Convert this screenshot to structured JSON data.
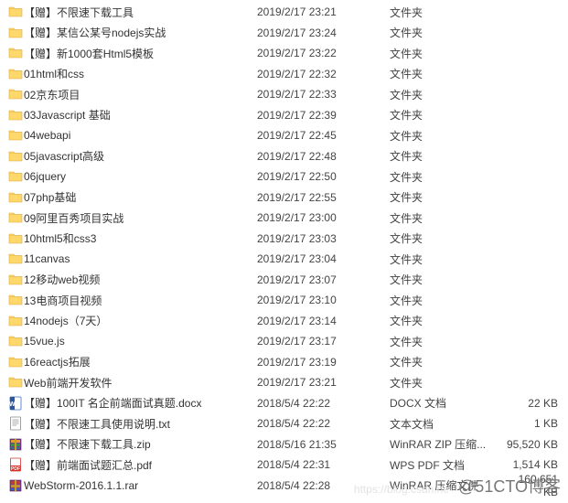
{
  "watermark": "@51CTO博客",
  "watermark_faint": "https://blog.csdn.ne",
  "icons": {
    "folder": "folder",
    "docx": "docx",
    "txt": "txt",
    "zip": "zip",
    "pdf": "pdf",
    "rar": "rar"
  },
  "rows": [
    {
      "icon": "folder",
      "name": "【赠】不限速下载工具",
      "date": "2019/2/17 23:21",
      "type": "文件夹",
      "size": ""
    },
    {
      "icon": "folder",
      "name": "【赠】某信公某号nodejs实战",
      "date": "2019/2/17 23:24",
      "type": "文件夹",
      "size": ""
    },
    {
      "icon": "folder",
      "name": "【赠】新1000套Html5模板",
      "date": "2019/2/17 23:22",
      "type": "文件夹",
      "size": ""
    },
    {
      "icon": "folder",
      "name": "01html和css",
      "date": "2019/2/17 22:32",
      "type": "文件夹",
      "size": ""
    },
    {
      "icon": "folder",
      "name": "02京东项目",
      "date": "2019/2/17 22:33",
      "type": "文件夹",
      "size": ""
    },
    {
      "icon": "folder",
      "name": "03Javascript 基础",
      "date": "2019/2/17 22:39",
      "type": "文件夹",
      "size": ""
    },
    {
      "icon": "folder",
      "name": "04webapi",
      "date": "2019/2/17 22:45",
      "type": "文件夹",
      "size": ""
    },
    {
      "icon": "folder",
      "name": "05javascript高级",
      "date": "2019/2/17 22:48",
      "type": "文件夹",
      "size": ""
    },
    {
      "icon": "folder",
      "name": "06jquery",
      "date": "2019/2/17 22:50",
      "type": "文件夹",
      "size": ""
    },
    {
      "icon": "folder",
      "name": "07php基础",
      "date": "2019/2/17 22:55",
      "type": "文件夹",
      "size": ""
    },
    {
      "icon": "folder",
      "name": "09阿里百秀项目实战",
      "date": "2019/2/17 23:00",
      "type": "文件夹",
      "size": ""
    },
    {
      "icon": "folder",
      "name": "10html5和css3",
      "date": "2019/2/17 23:03",
      "type": "文件夹",
      "size": ""
    },
    {
      "icon": "folder",
      "name": "11canvas",
      "date": "2019/2/17 23:04",
      "type": "文件夹",
      "size": ""
    },
    {
      "icon": "folder",
      "name": "12移动web视频",
      "date": "2019/2/17 23:07",
      "type": "文件夹",
      "size": ""
    },
    {
      "icon": "folder",
      "name": "13电商项目视频",
      "date": "2019/2/17 23:10",
      "type": "文件夹",
      "size": ""
    },
    {
      "icon": "folder",
      "name": "14nodejs（7天）",
      "date": "2019/2/17 23:14",
      "type": "文件夹",
      "size": ""
    },
    {
      "icon": "folder",
      "name": "15vue.js",
      "date": "2019/2/17 23:17",
      "type": "文件夹",
      "size": ""
    },
    {
      "icon": "folder",
      "name": "16reactjs拓展",
      "date": "2019/2/17 23:19",
      "type": "文件夹",
      "size": ""
    },
    {
      "icon": "folder",
      "name": "Web前端开发软件",
      "date": "2019/2/17 23:21",
      "type": "文件夹",
      "size": ""
    },
    {
      "icon": "docx",
      "name": "【赠】100IT 名企前端面试真题.docx",
      "date": "2018/5/4 22:22",
      "type": "DOCX 文档",
      "size": "22 KB"
    },
    {
      "icon": "txt",
      "name": "【赠】不限速工具使用说明.txt",
      "date": "2018/5/4 22:22",
      "type": "文本文档",
      "size": "1 KB"
    },
    {
      "icon": "zip",
      "name": "【赠】不限速下载工具.zip",
      "date": "2018/5/16 21:35",
      "type": "WinRAR ZIP 压缩...",
      "size": "95,520 KB"
    },
    {
      "icon": "pdf",
      "name": "【赠】前端面试题汇总.pdf",
      "date": "2018/5/4 22:31",
      "type": "WPS PDF 文档",
      "size": "1,514 KB"
    },
    {
      "icon": "rar",
      "name": "WebStorm-2016.1.1.rar",
      "date": "2018/5/4 22:28",
      "type": "WinRAR 压缩文件",
      "size": "160,651 KB"
    }
  ]
}
